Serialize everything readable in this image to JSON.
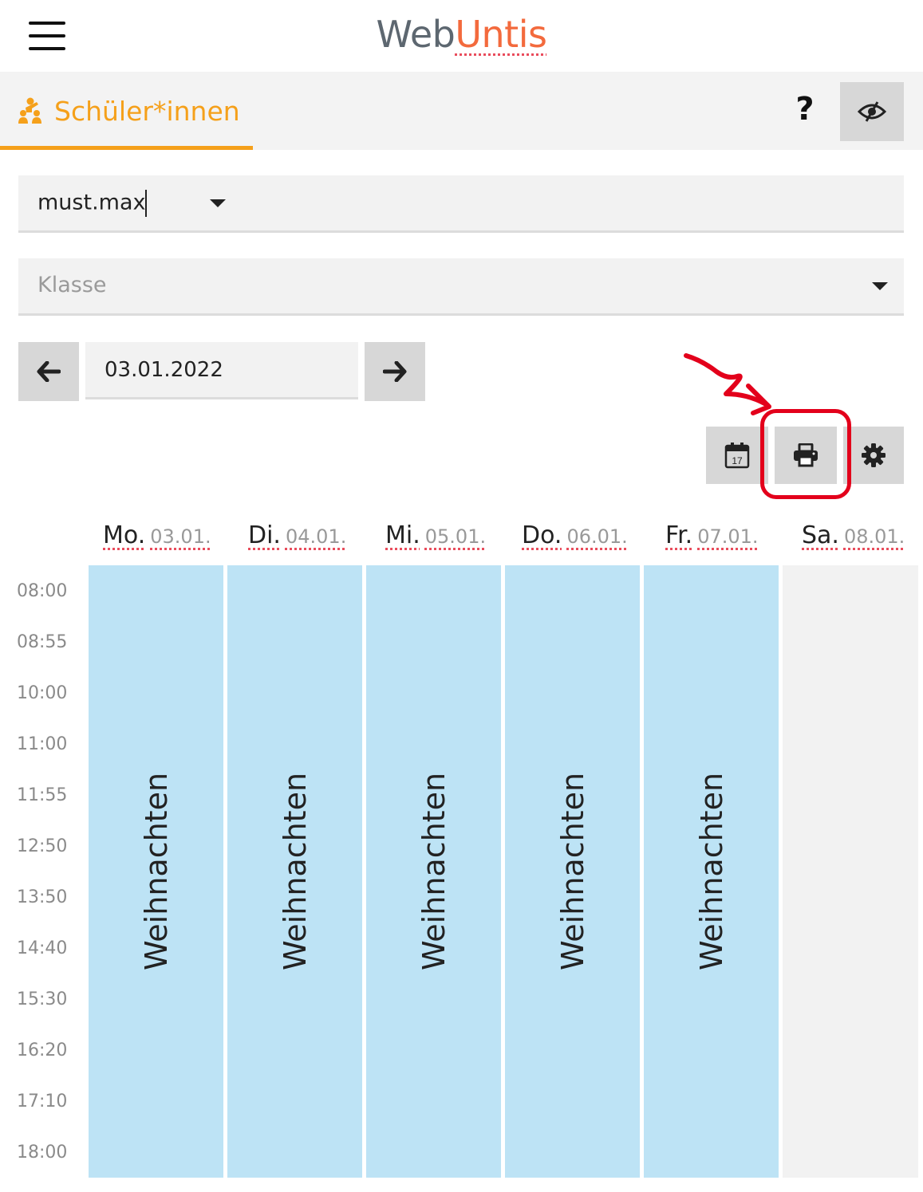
{
  "header": {
    "logo_web": "Web",
    "logo_untis": "Untis"
  },
  "tabs": {
    "active_label": "Schüler*innen",
    "help_label": "?"
  },
  "filters": {
    "student_value": "must.max",
    "class_placeholder": "Klasse"
  },
  "date_nav": {
    "date": "03.01.2022"
  },
  "timetable": {
    "days": [
      {
        "name": "Mo.",
        "date": "03.01.",
        "entry": "Weihnachten"
      },
      {
        "name": "Di.",
        "date": "04.01.",
        "entry": "Weihnachten"
      },
      {
        "name": "Mi.",
        "date": "05.01.",
        "entry": "Weihnachten"
      },
      {
        "name": "Do.",
        "date": "06.01.",
        "entry": "Weihnachten"
      },
      {
        "name": "Fr.",
        "date": "07.01.",
        "entry": "Weihnachten"
      },
      {
        "name": "Sa.",
        "date": "08.01.",
        "entry": ""
      }
    ],
    "times": [
      "08:00",
      "08:55",
      "10:00",
      "11:00",
      "11:55",
      "12:50",
      "13:50",
      "14:40",
      "15:30",
      "16:20",
      "17:10",
      "18:00"
    ]
  },
  "toolbar": {
    "calendar_day": "17"
  },
  "colors": {
    "accent_orange": "#f5a01a",
    "logo_orange": "#f36a3d",
    "holiday_blue": "#bde3f5",
    "annotation_red": "#e3001b"
  },
  "icons": [
    "menu-icon",
    "students-icon",
    "help-icon",
    "eye-off-icon",
    "arrow-left-icon",
    "arrow-right-icon",
    "calendar-icon",
    "printer-icon",
    "gear-icon"
  ]
}
